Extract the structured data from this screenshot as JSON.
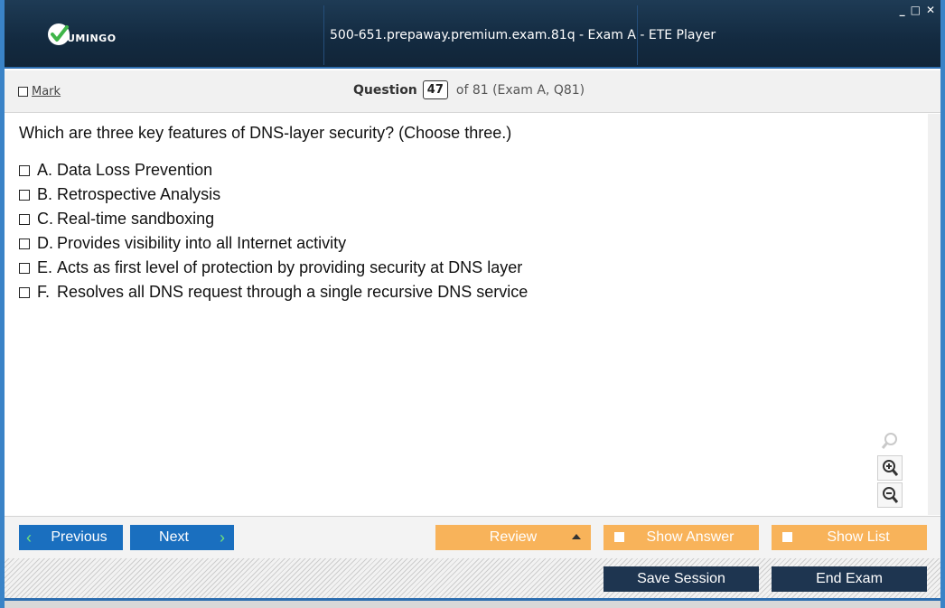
{
  "window": {
    "logo_text": "UMINGO",
    "title": "500-651.prepaway.premium.exam.81q - Exam A - ETE Player",
    "controls": [
      "minimize-icon",
      "maximize-icon",
      "close-icon"
    ],
    "control_glyphs": {
      "minimize": "_",
      "maximize": "□",
      "close": "✕"
    }
  },
  "header": {
    "mark_label": "Mark",
    "question_label": "Question",
    "question_number": "47",
    "question_of": "of 81 (Exam A, Q81)"
  },
  "question": {
    "text": "Which are three key features of DNS-layer security? (Choose three.)",
    "answers": [
      {
        "letter": "A.",
        "text": "Data Loss Prevention"
      },
      {
        "letter": "B.",
        "text": "Retrospective Analysis"
      },
      {
        "letter": "C.",
        "text": "Real-time sandboxing"
      },
      {
        "letter": "D.",
        "text": "Provides visibility into all Internet activity"
      },
      {
        "letter": "E.",
        "text": "Acts as first level of protection by providing security at DNS layer"
      },
      {
        "letter": "F.",
        "text": "Resolves all DNS request through a single recursive DNS service"
      }
    ]
  },
  "zoom": {
    "icons": [
      "zoom-reset-icon",
      "zoom-in-icon",
      "zoom-out-icon"
    ]
  },
  "nav": {
    "previous": "Previous",
    "next": "Next",
    "review": "Review",
    "show_answer": "Show Answer",
    "show_list": "Show List"
  },
  "bottom": {
    "save_session": "Save Session",
    "end_exam": "End Exam"
  },
  "colors": {
    "title_bg": "#132a40",
    "accent_blue": "#1a6fbf",
    "orange": "#f8b35a",
    "navy": "#1e3550",
    "check_green": "#72e27a"
  }
}
